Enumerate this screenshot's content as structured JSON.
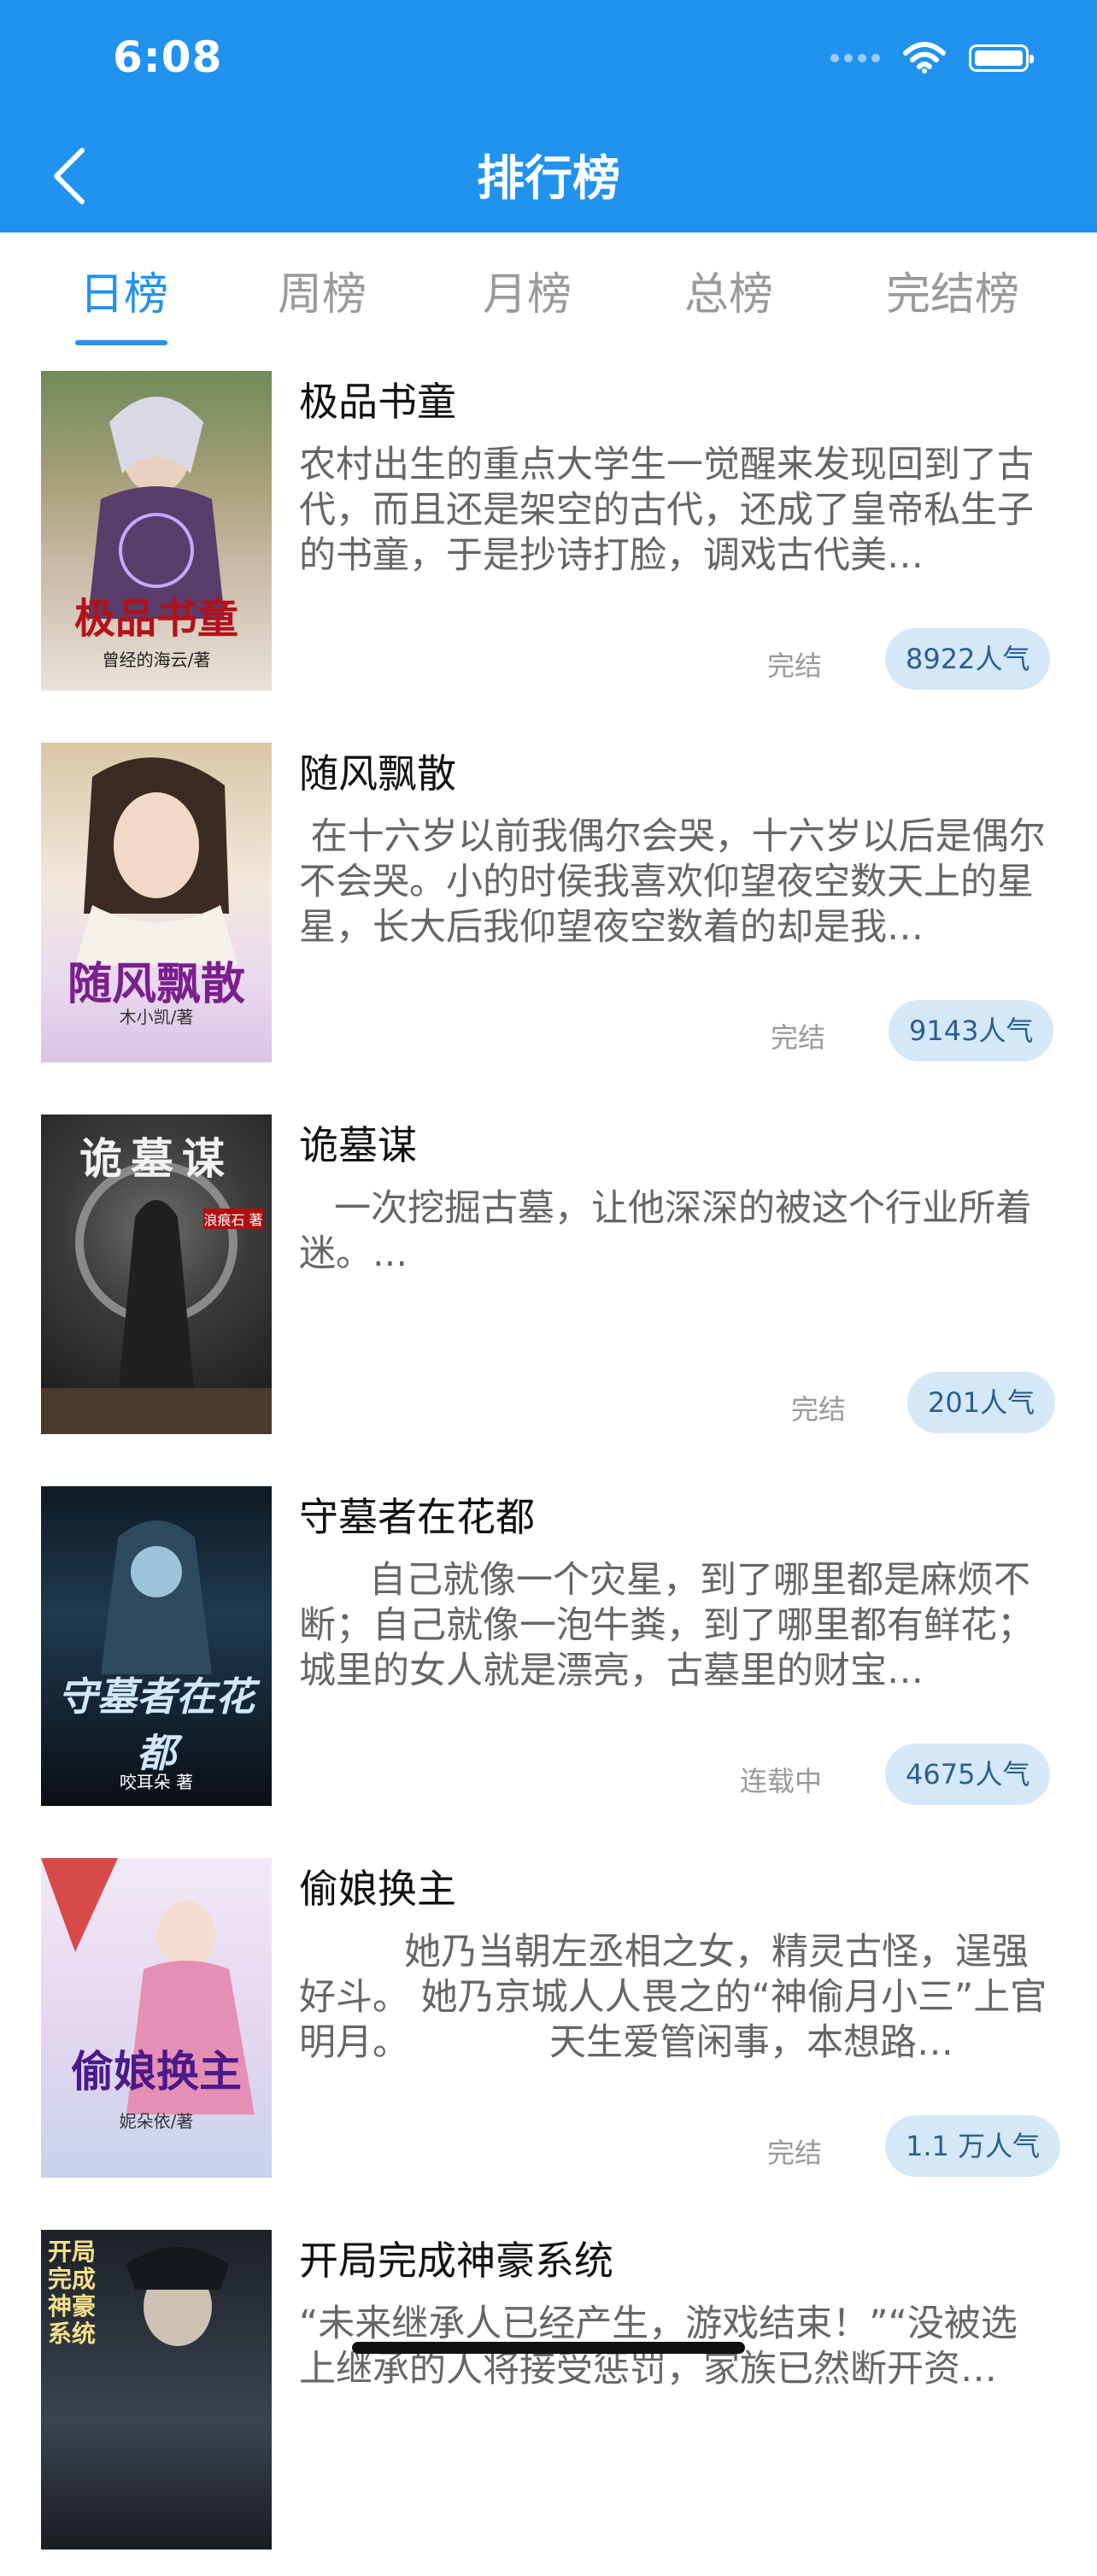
{
  "status_bar": {
    "time": "6:08"
  },
  "header": {
    "title": "排行榜"
  },
  "tabs": [
    {
      "label": "日榜",
      "active": true
    },
    {
      "label": "周榜",
      "active": false
    },
    {
      "label": "月榜",
      "active": false
    },
    {
      "label": "总榜",
      "active": false
    },
    {
      "label": "完结榜",
      "active": false
    }
  ],
  "books": [
    {
      "title": "极品书童",
      "desc": "农村出生的重点大学生一觉醒来发现回到了古代，而且还是架空的古代，还成了皇帝私生子的书童，于是抄诗打脸，调戏古代美…",
      "status": "完结",
      "popularity": "8922人气",
      "cover_title": "极品书童",
      "cover_author": "曾经的海云/著"
    },
    {
      "title": "随风飘散",
      "desc": " 在十六岁以前我偶尔会哭，十六岁以后是偶尔不会哭。小的时侯我喜欢仰望夜空数天上的星星，长大后我仰望夜空数着的却是我…",
      "status": "完结",
      "popularity": "9143人气",
      "cover_title": "随风飘散",
      "cover_author": "木小凯/著"
    },
    {
      "title": "诡墓谋",
      "desc": "   一次挖掘古墓，让他深深的被这个行业所着迷。...",
      "status": "完结",
      "popularity": "201人气",
      "cover_title": "诡墓谋",
      "cover_author": "浪痕石 著"
    },
    {
      "title": "守墓者在花都",
      "desc": "      自己就像一个灾星，到了哪里都是麻烦不断；自己就像一泡牛粪，到了哪里都有鲜花；城里的女人就是漂亮，古墓里的财宝…",
      "status": "连载中",
      "popularity": "4675人气",
      "cover_title": "守墓者在花都",
      "cover_author": "咬耳朵 著"
    },
    {
      "title": "偷娘换主",
      "desc": "         她乃当朝左丞相之女，精灵古怪，逞强好斗。 她乃京城人人畏之的“神偷月小三”上官明月。            天生爱管闲事，本想路…",
      "status": "完结",
      "popularity": "1.1 万人气",
      "cover_title": "偷娘换主",
      "cover_author": "妮朵依/著"
    },
    {
      "title": "开局完成神豪系统",
      "desc": "“未来继承人已经产生，游戏结束！”“没被选上继承的人将接受惩罚，家族已然断开资…",
      "status": "",
      "popularity": "",
      "cover_title": "开局完成神豪系统",
      "cover_author": ""
    }
  ]
}
